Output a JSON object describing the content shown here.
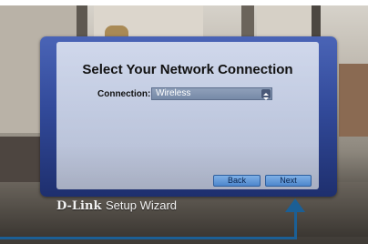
{
  "dialog": {
    "title": "Select Your Network Connection",
    "connection_label": "Connection:",
    "connection_value": "Wireless"
  },
  "buttons": {
    "back_label": "Back",
    "next_label": "Next"
  },
  "brand": {
    "logo_text": "D-Link",
    "subtitle": "Setup Wizard"
  },
  "colors": {
    "frame_blue": "#324a9a",
    "button_blue": "#4d86cc",
    "callout_blue": "#1b5f95"
  },
  "icons": {
    "select_arrow": "up-down-arrows-icon",
    "callout": "arrow-up-icon"
  }
}
